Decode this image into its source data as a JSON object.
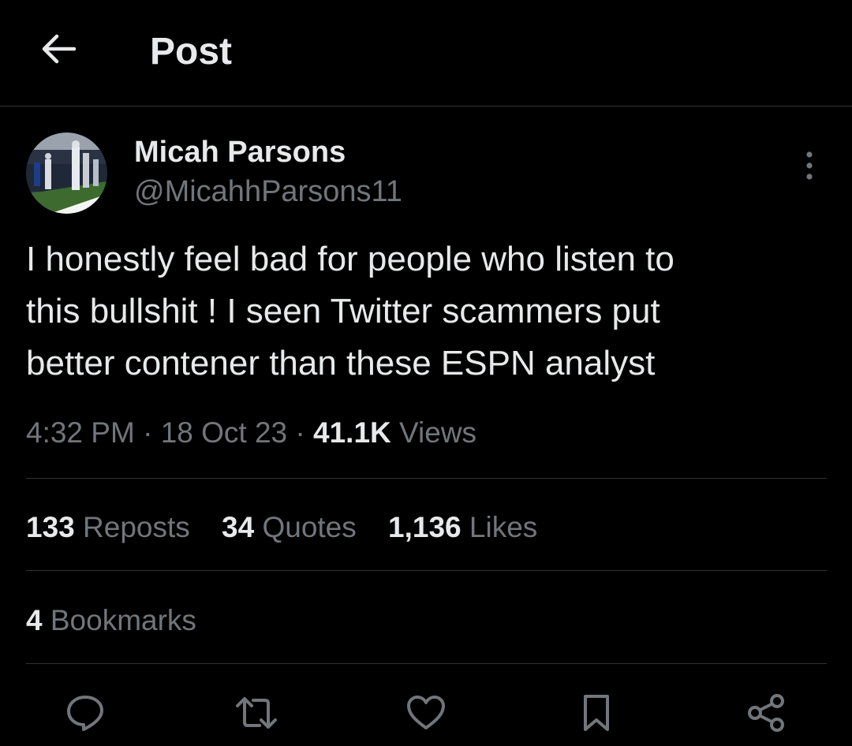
{
  "header": {
    "title": "Post",
    "back_icon": "arrow-left-icon"
  },
  "author": {
    "name": "Micah Parsons",
    "handle": "@MicahhParsons11",
    "avatar_icon": "avatar-photo"
  },
  "post": {
    "text": "I honestly feel bad for people who listen to\nthis bullshit ! I seen Twitter scammers put\nbetter contener than these ESPN analyst",
    "time": "4:32 PM",
    "date": "18 Oct 23",
    "separator": "·",
    "views_count": "41.1K",
    "views_label": "Views"
  },
  "stats": {
    "reposts_count": "133",
    "reposts_label": "Reposts",
    "quotes_count": "34",
    "quotes_label": "Quotes",
    "likes_count": "1,136",
    "likes_label": "Likes",
    "bookmarks_count": "4",
    "bookmarks_label": "Bookmarks"
  },
  "actions": {
    "reply_icon": "reply-icon",
    "repost_icon": "repost-icon",
    "like_icon": "heart-icon",
    "bookmark_icon": "bookmark-icon",
    "share_icon": "share-icon"
  },
  "colors": {
    "background": "#000000",
    "text_primary": "#e7e9ea",
    "text_secondary": "#71767b",
    "divider": "#2f3336"
  }
}
